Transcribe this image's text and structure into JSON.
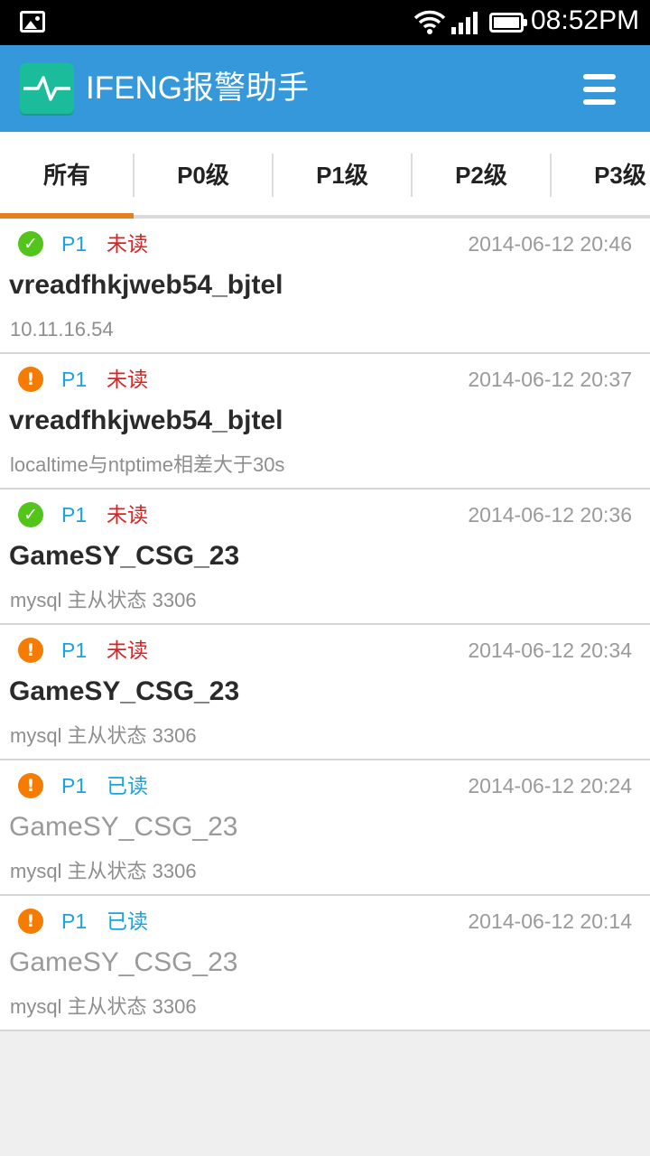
{
  "status_bar": {
    "time": "08:52PM",
    "icons": [
      "image-notification-icon",
      "wifi-icon",
      "signal-icon",
      "battery-icon"
    ]
  },
  "app_bar": {
    "title": "IFENG报警助手",
    "logo_icon": "pulse-icon",
    "menu_icon": "hamburger-menu-icon"
  },
  "tabs": [
    {
      "label": "所有",
      "selected": true
    },
    {
      "label": "P0级",
      "selected": false
    },
    {
      "label": "P1级",
      "selected": false
    },
    {
      "label": "P2级",
      "selected": false
    },
    {
      "label": "P3级",
      "selected": false
    }
  ],
  "alerts": [
    {
      "status": "ok",
      "level": "P1",
      "read_state": "未读",
      "read": false,
      "time": "2014-06-12 20:46",
      "host": "vreadfhkjweb54_bjtel",
      "message": "10.11.16.54"
    },
    {
      "status": "warning",
      "level": "P1",
      "read_state": "未读",
      "read": false,
      "time": "2014-06-12 20:37",
      "host": "vreadfhkjweb54_bjtel",
      "message": "localtime与ntptime相差大于30s"
    },
    {
      "status": "ok",
      "level": "P1",
      "read_state": "未读",
      "read": false,
      "time": "2014-06-12 20:36",
      "host": "GameSY_CSG_23",
      "message": "mysql 主从状态 3306"
    },
    {
      "status": "warning",
      "level": "P1",
      "read_state": "未读",
      "read": false,
      "time": "2014-06-12 20:34",
      "host": "GameSY_CSG_23",
      "message": "mysql 主从状态 3306"
    },
    {
      "status": "warning",
      "level": "P1",
      "read_state": "已读",
      "read": true,
      "time": "2014-06-12 20:24",
      "host": "GameSY_CSG_23",
      "message": "mysql 主从状态 3306"
    },
    {
      "status": "warning",
      "level": "P1",
      "read_state": "已读",
      "read": true,
      "time": "2014-06-12 20:14",
      "host": "GameSY_CSG_23",
      "message": "mysql 主从状态 3306"
    }
  ],
  "colors": {
    "app_bar": "#3498db",
    "logo": "#1abc9c",
    "tab_indicator": "#e67e22",
    "status_ok": "#52c41a",
    "status_warning": "#f57c00",
    "level_text": "#1aa3e0",
    "unread_text": "#e02020",
    "read_text": "#1aa3e0",
    "host_unread": "#2a2a2a",
    "host_read": "#9a9a9a"
  }
}
